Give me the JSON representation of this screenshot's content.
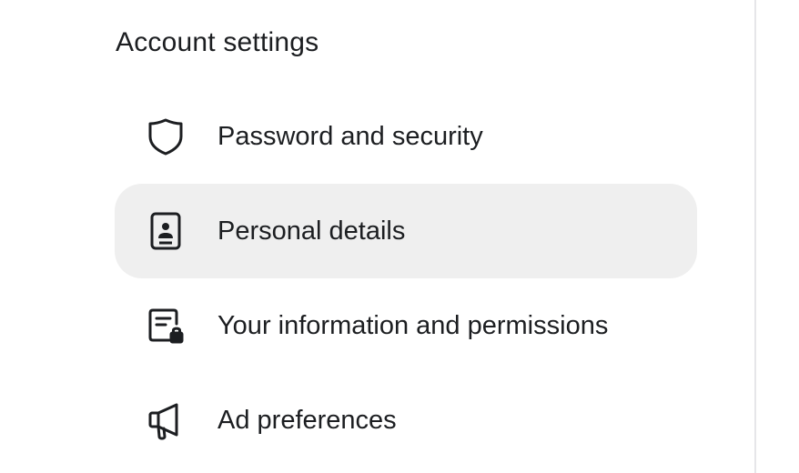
{
  "section": {
    "title": "Account settings"
  },
  "menu": {
    "items": [
      {
        "label": "Password and security",
        "icon": "shield-icon",
        "active": false
      },
      {
        "label": "Personal details",
        "icon": "id-card-icon",
        "active": true
      },
      {
        "label": "Your information and permissions",
        "icon": "document-lock-icon",
        "active": false
      },
      {
        "label": "Ad preferences",
        "icon": "megaphone-icon",
        "active": false
      }
    ]
  },
  "colors": {
    "active_background": "#efefef",
    "text": "#1c1e21",
    "divider": "#e6e6e9"
  }
}
